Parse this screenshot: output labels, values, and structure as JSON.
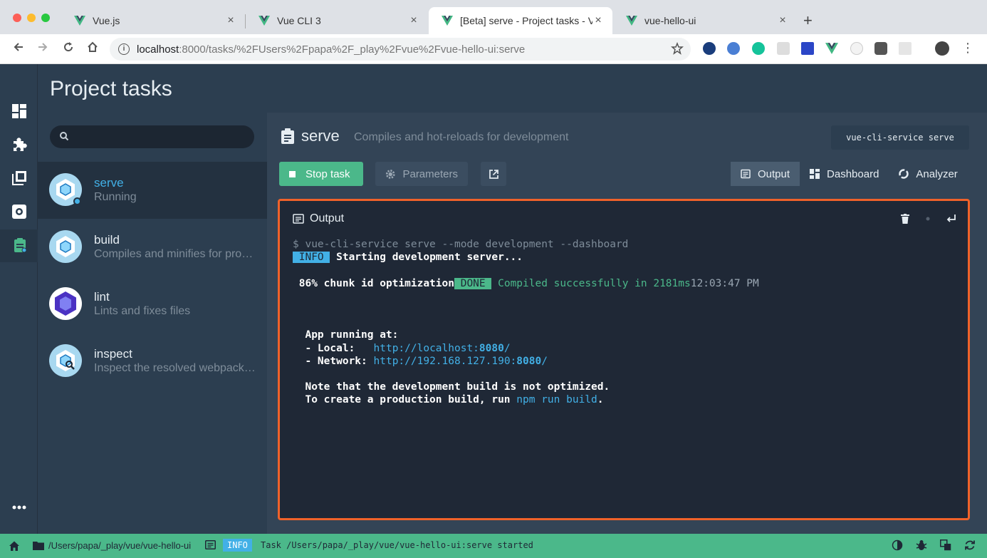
{
  "browser": {
    "tabs": [
      {
        "label": "Vue.js",
        "close": "×"
      },
      {
        "label": "Vue CLI 3",
        "close": "×"
      },
      {
        "label": "[Beta] serve - Project tasks - V",
        "close": "×"
      },
      {
        "label": "vue-hello-ui",
        "close": "×"
      }
    ],
    "new_tab": "+",
    "url_host": "localhost",
    "url_path": ":8000/tasks/%2FUsers%2Fpapa%2F_play%2Fvue%2Fvue-hello-ui:serve"
  },
  "app": {
    "title": "Project tasks",
    "search": {
      "placeholder": ""
    },
    "tasks": [
      {
        "name": "serve",
        "desc": "Running"
      },
      {
        "name": "build",
        "desc": "Compiles and minifies for production"
      },
      {
        "name": "lint",
        "desc": "Lints and fixes files"
      },
      {
        "name": "inspect",
        "desc": "Inspect the resolved webpack config"
      }
    ],
    "current": {
      "name": "serve",
      "description": "Compiles and hot-reloads for development",
      "command": "vue-cli-service serve"
    },
    "buttons": {
      "stop": "Stop task",
      "parameters": "Parameters"
    },
    "views": [
      "Output",
      "Dashboard",
      "Analyzer"
    ],
    "output": {
      "title": "Output",
      "lines": {
        "cmd": "$ vue-cli-service serve --mode development --dashboard",
        "info_tag": " INFO ",
        "starting": " Starting development server...",
        "progress": " 86% chunk id optimization",
        "done_tag": " DONE ",
        "compiled": " Compiled successfully in 2181ms",
        "time": "12:03:47 PM",
        "app_running": "  App running at:",
        "local_label": "  - Local:   ",
        "local_url_a": "http://localhost:",
        "local_port": "8080",
        "local_url_b": "/",
        "network_label": "  - Network: ",
        "network_url_a": "http://192.168.127.190:",
        "network_port": "8080",
        "network_url_b": "/",
        "note1": "  Note that the development build is not optimized.",
        "note2_a": "  To create a production build, run ",
        "note2_cmd": "npm run build",
        "note2_b": "."
      }
    }
  },
  "status": {
    "path": "/Users/papa/_play/vue/vue-hello-ui",
    "tag": "INFO",
    "message": "Task /Users/papa/_play/vue/vue-hello-ui:serve started"
  },
  "colors": {
    "accent_green": "#4bb88a",
    "accent_blue": "#42b0e6",
    "highlight_orange": "#f0622a"
  },
  "icons": [
    "dashboard-icon",
    "puzzle-icon",
    "dependencies-icon",
    "settings-icon",
    "tasks-icon",
    "more-icon"
  ]
}
